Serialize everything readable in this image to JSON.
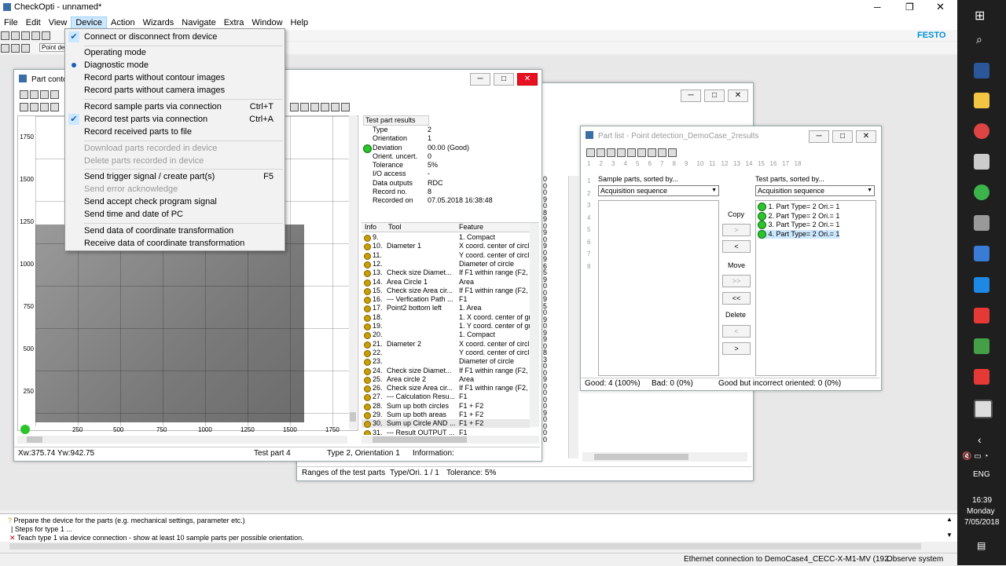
{
  "window_title": "CheckOpti - unnamed*",
  "menubar": [
    "File",
    "Edit",
    "View",
    "Device",
    "Action",
    "Wizards",
    "Navigate",
    "Extra",
    "Window",
    "Help"
  ],
  "brand": "FESTO",
  "toolbar2_text": "Point detec",
  "device_menu": {
    "connect": "Connect or disconnect from device",
    "operating": "Operating mode",
    "diagnostic": "Diagnostic mode",
    "rec_no_contour": "Record parts without contour images",
    "rec_no_camera": "Record parts without camera images",
    "rec_sample": "Record sample parts via connection",
    "rec_sample_sc": "Ctrl+T",
    "rec_test": "Record test parts via connection",
    "rec_test_sc": "Ctrl+A",
    "rec_file": "Record received parts to file",
    "download": "Download parts recorded in device",
    "delete": "Delete parts recorded in device",
    "trigger": "Send trigger signal / create part(s)",
    "trigger_sc": "F5",
    "error_ack": "Send error acknowledge",
    "accept_check": "Send accept check program signal",
    "time_date": "Send time and date of PC",
    "send_coord": "Send data of coordinate transformation",
    "recv_coord": "Receive data of coordinate transformation"
  },
  "part_window": {
    "title": "Part conto",
    "y_ticks": [
      "1750",
      "1500",
      "1250",
      "1000",
      "750",
      "500",
      "250"
    ],
    "x_ticks": [
      "250",
      "500",
      "750",
      "1000",
      "1250",
      "1500",
      "1750"
    ],
    "status_coords": "Xw:375.74 Yw:942.75",
    "status_part": "Test part 4",
    "status_type": "Type 2, Orientation 1",
    "status_info": "Information:",
    "results_header": "Test part results",
    "results": [
      {
        "k": "Type",
        "v": "2"
      },
      {
        "k": "Orientation",
        "v": "1"
      },
      {
        "k": "Deviation",
        "v": "00.00 (Good)"
      },
      {
        "k": "Orient. uncert.",
        "v": "0"
      },
      {
        "k": "Tolerance",
        "v": "5%"
      },
      {
        "k": "I/O access",
        "v": "-"
      },
      {
        "k": "Data outputs",
        "v": "RDC"
      },
      {
        "k": "Record no.",
        "v": "8"
      },
      {
        "k": "Recorded on",
        "v": "07.05.2018 16:38:48"
      }
    ],
    "tool_headers": [
      "Info",
      "Tool",
      "Feature"
    ],
    "tool_rows": [
      {
        "n": "9.",
        "t": "",
        "f": "1. Compact"
      },
      {
        "n": "10.",
        "t": "Diameter 1",
        "f": "X coord. center of circl"
      },
      {
        "n": "11.",
        "t": "",
        "f": "Y coord. center of circl"
      },
      {
        "n": "12.",
        "t": "",
        "f": "Diameter of circle"
      },
      {
        "n": "13.",
        "t": "Check size Diamet...",
        "f": "If F1 within range (F2, F"
      },
      {
        "n": "14.",
        "t": "Area Circle 1",
        "f": "Area"
      },
      {
        "n": "15.",
        "t": "Check size Area cir...",
        "f": "If F1 within range (F2, F"
      },
      {
        "n": "16.",
        "t": "--- Verfication Path ...",
        "f": "F1"
      },
      {
        "n": "17.",
        "t": "Point2 bottom left",
        "f": "1. Area"
      },
      {
        "n": "18.",
        "t": "",
        "f": "1. X coord. center of gr"
      },
      {
        "n": "19.",
        "t": "",
        "f": "1. Y coord. center of gr"
      },
      {
        "n": "20.",
        "t": "",
        "f": "1. Compact"
      },
      {
        "n": "21.",
        "t": "Diameter 2",
        "f": "X coord. center of circl"
      },
      {
        "n": "22.",
        "t": "",
        "f": "Y coord. center of circl"
      },
      {
        "n": "23.",
        "t": "",
        "f": "Diameter of circle"
      },
      {
        "n": "24.",
        "t": "Check size Diamet...",
        "f": "If F1 within range (F2, F"
      },
      {
        "n": "25.",
        "t": "Area circle 2",
        "f": "Area"
      },
      {
        "n": "26.",
        "t": "Check size Area cir...",
        "f": "If F1 within range (F2, F"
      },
      {
        "n": "27.",
        "t": "--- Calculation Resu...",
        "f": "F1"
      },
      {
        "n": "28.",
        "t": "Sum up both circles",
        "f": "F1 + F2"
      },
      {
        "n": "29.",
        "t": "Sum up both areas",
        "f": "F1 + F2"
      },
      {
        "n": "30.",
        "t": "Sum up Circle AND ...",
        "f": "F1 + F2"
      },
      {
        "n": "31.",
        "t": "--- Result OUTPUT ...",
        "f": "F1"
      }
    ]
  },
  "ranges_window": {
    "status_ranges": "Ranges of the test parts",
    "status_type": "Type/Ori. 1 / 1",
    "status_tol": "Tolerance: 5%"
  },
  "part_list": {
    "title": "Part list - Point detection_DemoCase_2results",
    "numbers": [
      "1",
      "2",
      "3",
      "4",
      "5",
      "6",
      "7",
      "8",
      "9",
      "10",
      "11",
      "12",
      "13",
      "14",
      "15",
      "16",
      "17",
      "18"
    ],
    "sample_label": "Sample parts, sorted by...",
    "sample_sort": "Acquisition sequence",
    "test_label": "Test parts, sorted by...",
    "test_sort": "Acquisition sequence",
    "copy": "Copy",
    "move": "Move",
    "delete": "Delete",
    "btn_right": ">",
    "btn_left": "<",
    "btn_rr": ">>",
    "btn_ll": "<<",
    "test_parts": [
      "1. Part Type= 2 Ori.= 1",
      "2. Part Type= 2 Ori.= 1",
      "3. Part Type= 2 Ori.= 1",
      "4. Part Type= 2 Ori.= 1"
    ],
    "good": "Good: 4 (100%)",
    "bad": "Bad: 0 (0%)",
    "good_incorrect": "Good but incorrect oriented: 0 (0%)"
  },
  "log": [
    "Prepare the device for the parts (e.g. mechanical settings, parameter etc.)",
    "Steps for type 1 ...",
    "Teach type 1 via device connection - show at least 10 sample parts per possible orientation."
  ],
  "status": {
    "connection": "Ethernet connection to DemoCase4_CECC-X-M1-MV (192.",
    "mode": "Observe system"
  },
  "taskbar": {
    "lang": "ENG",
    "time": "16:39",
    "day": "Monday",
    "date": "7/05/2018"
  }
}
